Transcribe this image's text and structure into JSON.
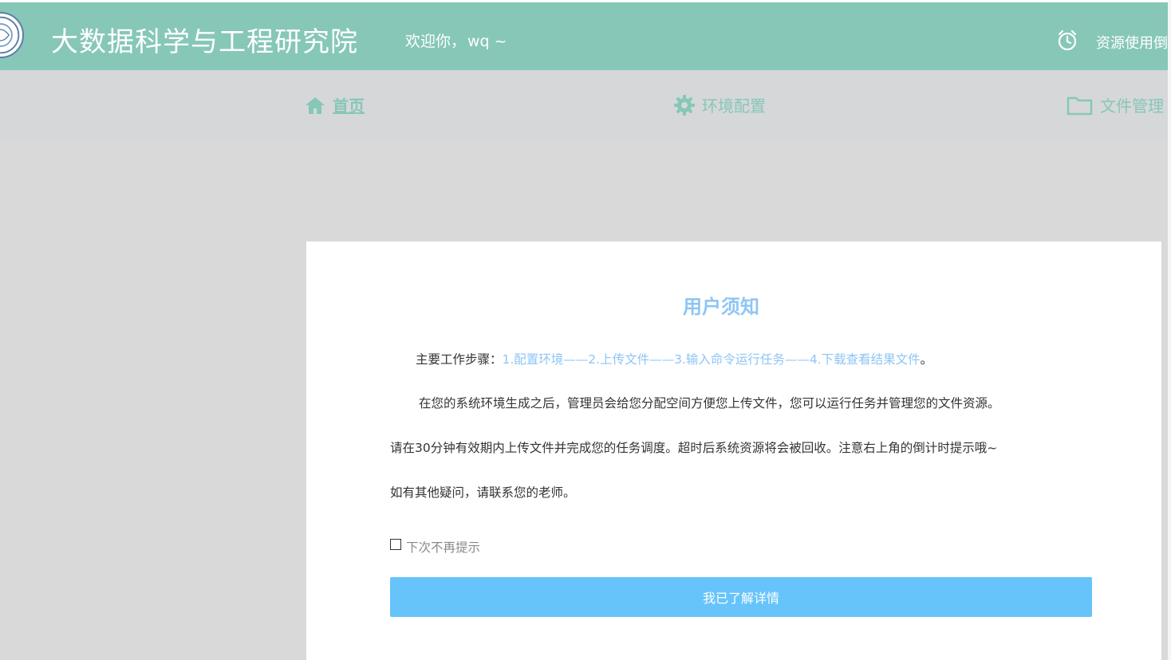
{
  "header": {
    "site_title": "大数据科学与工程研究院",
    "welcome_text": "欢迎你，",
    "username": "wq ~",
    "resource_timer_text": "资源使用倒计",
    "colors": {
      "header_bg": "#86c7b8",
      "text": "#ffffff"
    },
    "icons": {
      "logo": "institute-logo",
      "timer": "alarm-clock-icon"
    }
  },
  "nav": {
    "items": [
      {
        "label": "首页",
        "icon": "home-icon",
        "active": true
      },
      {
        "label": "环境配置",
        "icon": "gear-icon",
        "active": false
      },
      {
        "label": "文件管理",
        "icon": "folder-icon",
        "active": false
      }
    ],
    "accent_color": "#86c7b8"
  },
  "notice": {
    "title": "用户须知",
    "steps_prefix": "主要工作步骤：",
    "steps_highlight": "1.配置环境——2.上传文件——3.输入命令运行任务——4.下载查看结果文件",
    "steps_suffix": "。",
    "paragraph_1": "在您的系统环境生成之后，管理员会给您分配空间方便您上传文件，您可以运行任务并管理您的文件资源。",
    "paragraph_2": "请在30分钟有效期内上传文件并完成您的任务调度。超时后系统资源将会被回收。注意右上角的倒计时提示哦~",
    "paragraph_3": "如有其他疑问，请联系您的老师。",
    "dont_show_label": "下次不再提示",
    "dont_show_checked": false,
    "confirm_button": "我已了解详情",
    "colors": {
      "title": "#8ec5f5",
      "button_bg": "#66c4fa"
    }
  }
}
